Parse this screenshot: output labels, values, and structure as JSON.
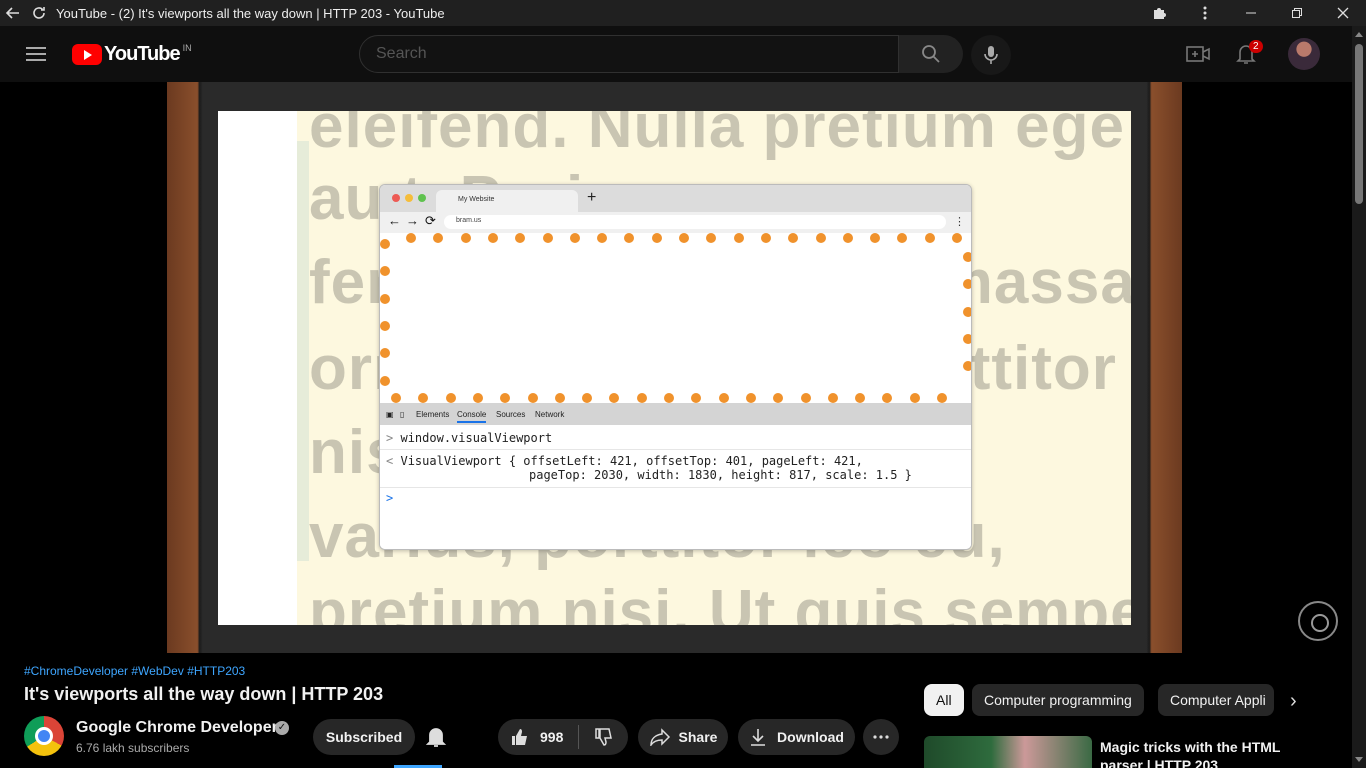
{
  "window": {
    "title": "YouTube - (2) It's viewports all the way down | HTTP 203 - YouTube"
  },
  "header": {
    "logo_text": "YouTube",
    "logo_country": "IN",
    "search_placeholder": "Search",
    "notification_count": "2"
  },
  "video": {
    "slide": {
      "lorem_lines": [
        "eleifend. Nulla pretium ege",
        "au                    t. Proin",
        "fermentum metus in massa",
        "ornare, bibendum porttitor",
        "nis                          eo",
        "varius, porttitor leo eu,",
        "pretium nisi. Ut quis sempe"
      ],
      "mock_browser": {
        "tab_label": "My Website",
        "url": "bram.us",
        "devtools_tabs": [
          "Elements",
          "Console",
          "Sources",
          "Network"
        ],
        "active_devtools_tab": "Console",
        "console_input": "window.visualViewport",
        "console_output_line1": "VisualViewport { offsetLeft: 421, offsetTop: 401, pageLeft: 421,",
        "console_output_line2": "pageTop: 2030, width: 1830, height: 817, scale: 1.5 }",
        "prompt": ">"
      }
    },
    "hashtags": "#ChromeDeveloper #WebDev #HTTP203",
    "title": "It's viewports all the way down | HTTP 203",
    "channel_name": "Google Chrome Developers",
    "subscribers": "6.76 lakh subscribers",
    "subscribe_label": "Subscribed",
    "likes": "998",
    "share_label": "Share",
    "download_label": "Download"
  },
  "chips": [
    "All",
    "Computer programming",
    "Computer Appli"
  ],
  "recommendation": {
    "title": "Magic tricks with the HTML parser | HTTP 203"
  },
  "colors": {
    "accent_link": "#3ea6ff",
    "youtube_red": "#ff0000",
    "viewport_dots": "#f0922c"
  }
}
